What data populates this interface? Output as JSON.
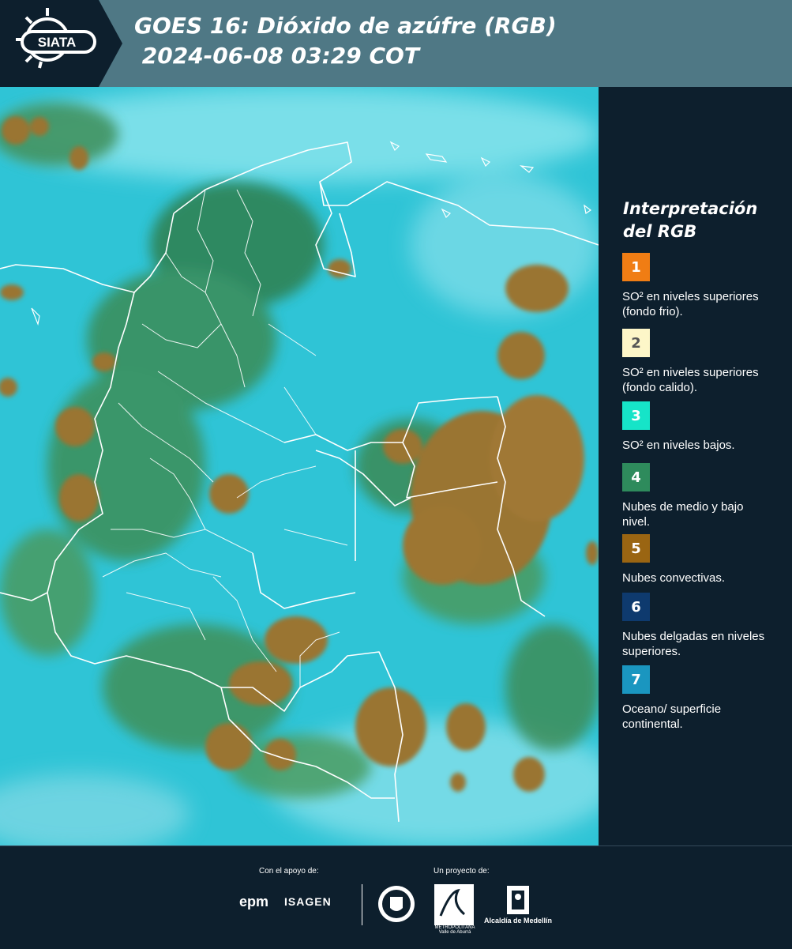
{
  "header": {
    "logo_text": "SIATA",
    "title_line1": "GOES 16: Dióxido de azúfre (RGB)",
    "title_line2": " 2024-06-08 03:29 COT"
  },
  "legend": {
    "title": "Interpretación del RGB",
    "items": [
      {
        "number": "1",
        "color": "#f07d14",
        "label": "SO² en niveles superiores (fondo frio)."
      },
      {
        "number": "2",
        "color": "#fdf6c8",
        "label": "SO² en niveles superiores (fondo calido)."
      },
      {
        "number": "3",
        "color": "#16e4c8",
        "label": "SO² en niveles bajos."
      },
      {
        "number": "4",
        "color": "#2e8b5c",
        "label": "Nubes de medio y bajo nivel."
      },
      {
        "number": "5",
        "color": "#9a6512",
        "label": "Nubes convectivas."
      },
      {
        "number": "6",
        "color": "#0e3a6e",
        "label": "Nubes delgadas en niveles superiores."
      },
      {
        "number": "7",
        "color": "#1a96c0",
        "label": "Oceano/ superficie continental."
      }
    ]
  },
  "footer": {
    "support_label": "Con el apoyo de:",
    "project_label": "Un proyecto de:",
    "epm": "epm",
    "isagen": "ISAGEN",
    "area_text": "METROPOLITANA Valle de Aburrá",
    "alcaldia": "Alcaldía de Medellín"
  },
  "colors": {
    "header_bg": "#4f7885",
    "panel_bg": "#0d1f2d",
    "ocean_cyan": "#2fc4d6",
    "convective_brown": "#9a7430",
    "cloud_green": "#3f8f55"
  }
}
